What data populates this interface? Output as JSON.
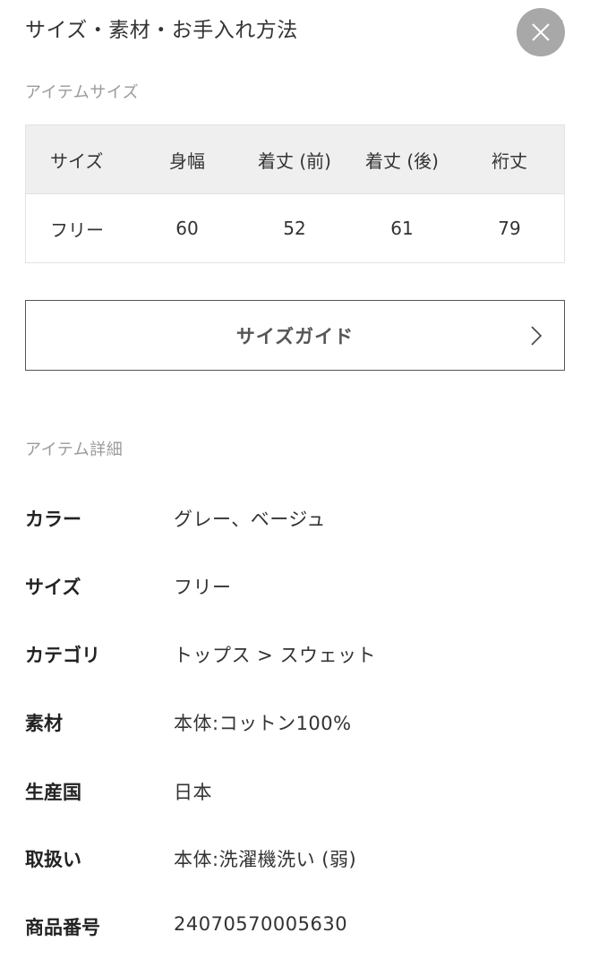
{
  "header": {
    "title": "サイズ・素材・お手入れ方法"
  },
  "size_section": {
    "label": "アイテムサイズ",
    "columns": [
      "サイズ",
      "身幅",
      "着丈 (前)",
      "着丈 (後)",
      "裄丈"
    ],
    "rows": [
      [
        "フリー",
        "60",
        "52",
        "61",
        "79"
      ]
    ]
  },
  "size_guide": {
    "label": "サイズガイド"
  },
  "detail_section": {
    "label": "アイテム詳細",
    "items": [
      {
        "key": "カラー",
        "value": "グレー、ベージュ"
      },
      {
        "key": "サイズ",
        "value": "フリー"
      },
      {
        "key": "カテゴリ",
        "value": "トップス > スウェット"
      },
      {
        "key": "素材",
        "value": "本体:コットン100%"
      },
      {
        "key": "生産国",
        "value": "日本"
      },
      {
        "key": "取扱い",
        "value": "本体:洗濯機洗い (弱)"
      },
      {
        "key": "商品番号",
        "value": "24070570005630"
      }
    ]
  },
  "icons": {
    "close": "close-icon",
    "collapse": "chevron-down-icon",
    "guide": "chevron-right-icon"
  },
  "colors": {
    "close_bg": "#a8a8a8",
    "table_header_bg": "#efefef",
    "label_gray": "#9a9a9a"
  }
}
